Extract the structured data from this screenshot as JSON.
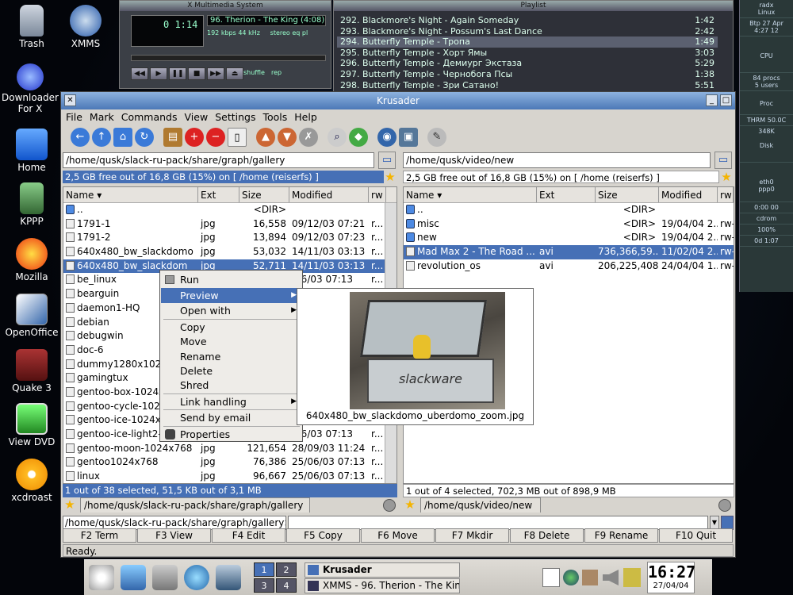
{
  "desktop": {
    "icons": [
      "Trash",
      "XMMS",
      "Downloader For X",
      "Home",
      "KPPP",
      "Mozilla",
      "OpenOffice",
      "Quake 3",
      "View DVD",
      "xcdroast"
    ]
  },
  "xmms": {
    "title": "X Multimedia System",
    "time": "0 1:14",
    "song": "96. Therion - The King (4:08)",
    "bitrate": "192",
    "kbps": "kbps",
    "khz": "44",
    "khz_label": "kHz",
    "mode": "stereo",
    "eq": "eq",
    "pl": "pl",
    "shuffle": "shuffle",
    "rep": "rep"
  },
  "playlist": {
    "title": "Playlist",
    "rows": [
      {
        "title": "292. Blackmore's Night - Again Someday",
        "time": "1:42"
      },
      {
        "title": "293. Blackmore's Night - Possum's Last Dance",
        "time": "2:42"
      },
      {
        "title": "294. Butterfly Temple - Тропа",
        "time": "1:49"
      },
      {
        "title": "295. Butterfly Temple - Хорт Ямы",
        "time": "3:03"
      },
      {
        "title": "296. Butterfly Temple - Демиург Экстаза",
        "time": "5:29"
      },
      {
        "title": "297. Butterfly Temple - Чернобога Псы",
        "time": "1:38"
      },
      {
        "title": "298. Butterfly Temple - Зри Сатано!",
        "time": "5:51"
      }
    ]
  },
  "gkrellm": {
    "host": "radx",
    "os": "Linux",
    "date": "Btp 27 Apr",
    "time": "4:27 12",
    "cpu": "CPU",
    "procs": "84 procs",
    "users": "5 users",
    "proc": "Proc",
    "therm": "THRM 50.0C",
    "mem": "348K",
    "disk": "Disk",
    "eth": "eth0",
    "ppp": "ppp0",
    "clock": "0:00 00",
    "cdrom": "cdrom",
    "bat": "100%",
    "uptime": "0d 1:07"
  },
  "krusader": {
    "title": "Krusader",
    "menu": [
      "File",
      "Mark",
      "Commands",
      "View",
      "Settings",
      "Tools",
      "Help"
    ],
    "left": {
      "path": "/home/qusk/slack-ru-pack/share/graph/gallery",
      "free": "2,5 GB free out of 16,8 GB (15%) on [ /home (reiserfs) ]",
      "headers": {
        "name": "Name",
        "ext": "Ext",
        "size": "Size",
        "modified": "Modified",
        "perm": "rw"
      },
      "rows": [
        {
          "name": "..",
          "ext": "",
          "size": "<DIR>",
          "modified": "",
          "perm": "",
          "dir": true
        },
        {
          "name": "1791-1",
          "ext": "jpg",
          "size": "16,558",
          "modified": "09/12/03 07:21",
          "perm": "r..."
        },
        {
          "name": "1791-2",
          "ext": "jpg",
          "size": "13,894",
          "modified": "09/12/03 07:23",
          "perm": "r..."
        },
        {
          "name": "640x480_bw_slackdomo",
          "ext": "jpg",
          "size": "53,032",
          "modified": "14/11/03 03:13",
          "perm": "r..."
        },
        {
          "name": "640x480_bw_slackdom",
          "ext": "jpg",
          "size": "52,711",
          "modified": "14/11/03 03:13",
          "perm": "r...",
          "sel": true
        },
        {
          "name": "be_linux",
          "ext": "",
          "size": "",
          "modified": "/06/03 07:13",
          "perm": "r..."
        },
        {
          "name": "bearguin",
          "ext": "",
          "size": "",
          "modified": "",
          "perm": ""
        },
        {
          "name": "daemon1-HQ",
          "ext": "",
          "size": "",
          "modified": "",
          "perm": ""
        },
        {
          "name": "debian",
          "ext": "",
          "size": "",
          "modified": "",
          "perm": ""
        },
        {
          "name": "debugwin",
          "ext": "",
          "size": "",
          "modified": "",
          "perm": ""
        },
        {
          "name": "doc-6",
          "ext": "",
          "size": "",
          "modified": "",
          "perm": ""
        },
        {
          "name": "dummy1280x1024",
          "ext": "",
          "size": "",
          "modified": "",
          "perm": ""
        },
        {
          "name": "gamingtux",
          "ext": "",
          "size": "",
          "modified": "",
          "perm": ""
        },
        {
          "name": "gentoo-box-1024x",
          "ext": "",
          "size": "",
          "modified": "",
          "perm": ""
        },
        {
          "name": "gentoo-cycle-1024",
          "ext": "",
          "size": "",
          "modified": "",
          "perm": ""
        },
        {
          "name": "gentoo-ice-1024x7",
          "ext": "",
          "size": "",
          "modified": "",
          "perm": ""
        },
        {
          "name": "gentoo-ice-light2-1",
          "ext": "",
          "size": "",
          "modified": "/06/03 07:13",
          "perm": "r..."
        },
        {
          "name": "gentoo-moon-1024x768",
          "ext": "jpg",
          "size": "121,654",
          "modified": "28/09/03 11:24",
          "perm": "r..."
        },
        {
          "name": "gentoo1024x768",
          "ext": "jpg",
          "size": "76,386",
          "modified": "25/06/03 07:13",
          "perm": "r..."
        },
        {
          "name": "linux",
          "ext": "jpg",
          "size": "96,667",
          "modified": "25/06/03 07:13",
          "perm": "r..."
        }
      ],
      "status": "1 out of 38 selected, 51,5 KB out of 3,1 MB"
    },
    "right": {
      "path": "/home/qusk/video/new",
      "free": "2,5 GB free out of 16,8 GB (15%) on [ /home (reiserfs) ]",
      "headers": {
        "name": "Name",
        "ext": "Ext",
        "size": "Size",
        "modified": "Modified",
        "perm": "rw"
      },
      "rows": [
        {
          "name": "..",
          "ext": "",
          "size": "<DIR>",
          "modified": "",
          "perm": "",
          "dir": true
        },
        {
          "name": "misc",
          "ext": "",
          "size": "<DIR>",
          "modified": "19/04/04 2...",
          "perm": "rw-",
          "dir": true
        },
        {
          "name": "new",
          "ext": "",
          "size": "<DIR>",
          "modified": "19/04/04 2...",
          "perm": "rw-",
          "dir": true
        },
        {
          "name": "Mad Max 2 - The Road ...",
          "ext": "avi",
          "size": "736,366,59...",
          "modified": "11/02/04 2...",
          "perm": "rw-",
          "sel": true
        },
        {
          "name": "revolution_os",
          "ext": "avi",
          "size": "206,225,408",
          "modified": "24/04/04 1...",
          "perm": "rw-"
        }
      ],
      "status": "1 out of 4 selected, 702,3 MB out of 898,9 MB"
    },
    "cmd_prompt": "/home/qusk/slack-ru-pack/share/graph/gallery>",
    "fkeys": [
      "F2 Term",
      "F3 View",
      "F4 Edit",
      "F5 Copy",
      "F6 Move",
      "F7 Mkdir",
      "F8 Delete",
      "F9 Rename",
      "F10 Quit"
    ],
    "status": "Ready."
  },
  "context_menu": {
    "items": [
      "Run",
      "Preview",
      "Open with",
      "Copy",
      "Move",
      "Rename",
      "Delete",
      "Shred",
      "Link handling",
      "Send by email",
      "Properties"
    ]
  },
  "preview": {
    "caption": "640x480_bw_slackdomo_uberdomo_zoom.jpg",
    "logo": "slackware"
  },
  "taskbar": {
    "pager": [
      "1",
      "2",
      "3",
      "4"
    ],
    "tasks": [
      "Krusader",
      "XMMS - 96. Therion - The Kin"
    ],
    "clock": "16:27",
    "date": "27/04/04"
  }
}
